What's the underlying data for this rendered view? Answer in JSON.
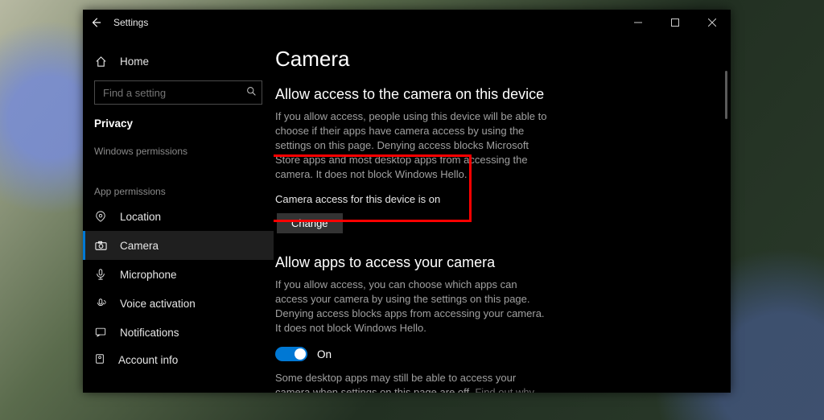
{
  "titlebar": {
    "title": "Settings"
  },
  "sidebar": {
    "home": "Home",
    "search_placeholder": "Find a setting",
    "group": "Privacy",
    "win_perm": "Windows permissions",
    "app_perm": "App permissions",
    "items": {
      "location": "Location",
      "camera": "Camera",
      "microphone": "Microphone",
      "voice": "Voice activation",
      "notifications": "Notifications",
      "account": "Account info"
    }
  },
  "content": {
    "title": "Camera",
    "sec1_h": "Allow access to the camera on this device",
    "sec1_p": "If you allow access, people using this device will be able to choose if their apps have camera access by using the settings on this page. Denying access blocks Microsoft Store apps and most desktop apps from accessing the camera. It does not block Windows Hello.",
    "status": "Camera access for this device is on",
    "change": "Change",
    "sec2_h": "Allow apps to access your camera",
    "sec2_p": "If you allow access, you can choose which apps can access your camera by using the settings on this page. Denying access blocks apps from accessing your camera. It does not block Windows Hello.",
    "toggle": "On",
    "note": "Some desktop apps may still be able to access your camera when settings on this page are off. ",
    "note_link": "Find out why"
  }
}
